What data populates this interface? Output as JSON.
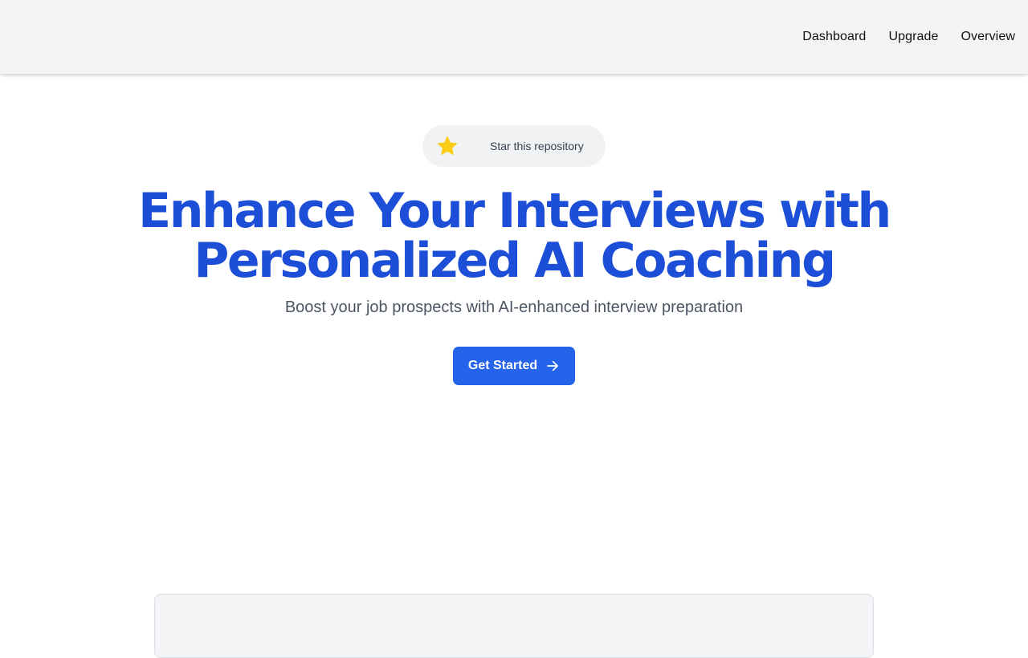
{
  "nav": {
    "items": [
      {
        "label": "Dashboard"
      },
      {
        "label": "Upgrade"
      },
      {
        "label": "Overview"
      }
    ]
  },
  "star_badge": {
    "icon": "star-icon",
    "label": "Star this repository",
    "icon_color": "#facc15"
  },
  "hero": {
    "headline_line1": "Enhance Your Interviews with",
    "headline_line2": "Personalized AI Coaching",
    "subtitle": "Boost your job prospects with AI-enhanced interview preparation",
    "cta_label": "Get Started",
    "cta_icon": "arrow-right-icon"
  },
  "colors": {
    "accent": "#1d4ed8",
    "button": "#2563eb",
    "navbar_bg": "#f4f4f5"
  }
}
